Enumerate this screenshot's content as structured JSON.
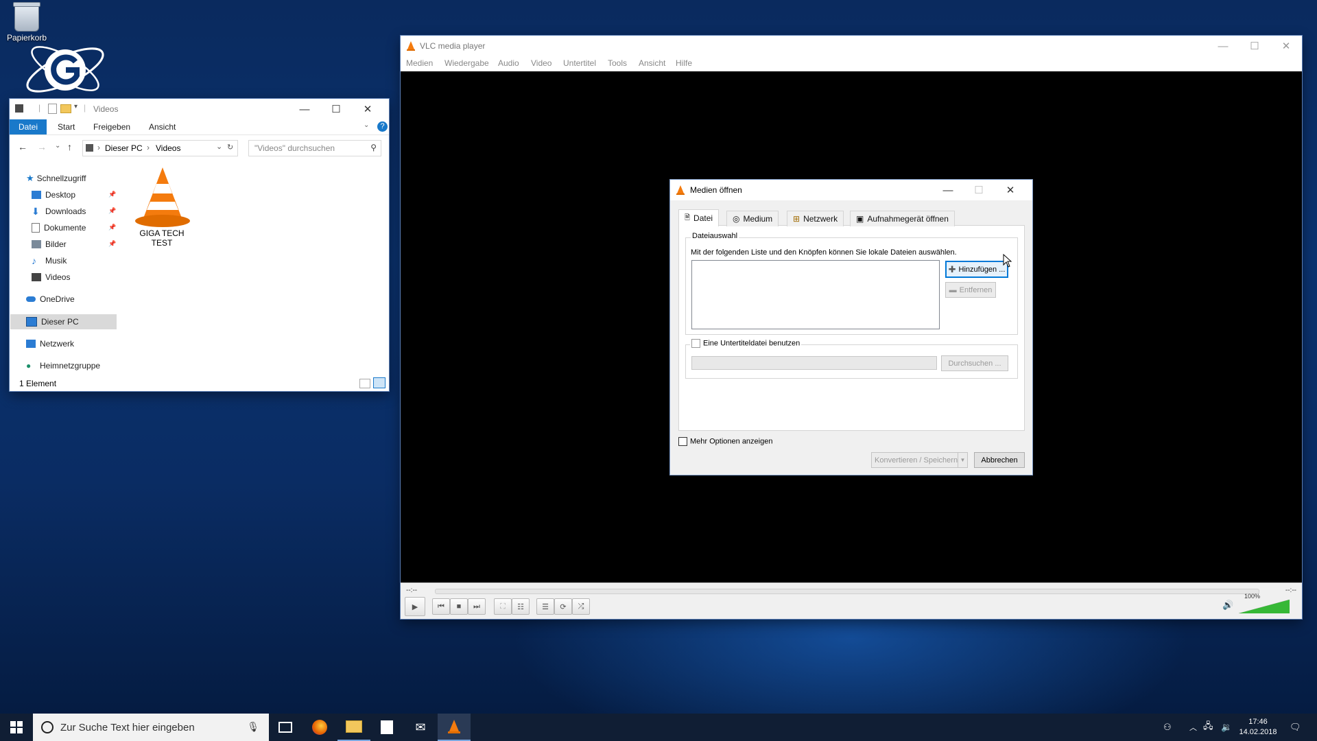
{
  "desktop": {
    "icon_label": "Papierkorb"
  },
  "explorer": {
    "title": "Videos",
    "ribbon": {
      "file": "Datei",
      "start": "Start",
      "share": "Freigeben",
      "view": "Ansicht"
    },
    "address": {
      "crumbs": [
        "Dieser PC",
        "Videos"
      ]
    },
    "search_placeholder": "\"Videos\" durchsuchen",
    "sidebar": {
      "quick_access": "Schnellzugriff",
      "items": [
        "Desktop",
        "Downloads",
        "Dokumente",
        "Bilder",
        "Musik",
        "Videos"
      ],
      "onedrive": "OneDrive",
      "this_pc": "Dieser PC",
      "network": "Netzwerk",
      "homegroup": "Heimnetzgruppe"
    },
    "file": {
      "name": "GIGA TECH TEST"
    },
    "status": "1 Element"
  },
  "vlc": {
    "title": "VLC media player",
    "menu": [
      "Medien",
      "Wiedergabe",
      "Audio",
      "Video",
      "Untertitel",
      "Tools",
      "Ansicht",
      "Hilfe"
    ],
    "time_left": "--:--",
    "time_right": "--:--",
    "volume_label": "100%",
    "volume_fraction": 1.0
  },
  "dialog": {
    "title": "Medien öffnen",
    "tabs": [
      "Datei",
      "Medium",
      "Netzwerk",
      "Aufnahmegerät öffnen"
    ],
    "group_title": "Dateiauswahl",
    "description": "Mit der folgenden Liste und den Knöpfen können Sie lokale Dateien auswählen.",
    "add_button": "Hinzufügen ...",
    "remove_button": "Entfernen",
    "subtitle_checkbox": "Eine Untertiteldatei benutzen",
    "browse_button": "Durchsuchen ...",
    "more_options": "Mehr Optionen anzeigen",
    "convert_button": "Konvertieren / Speichern",
    "cancel_button": "Abbrechen"
  },
  "taskbar": {
    "search_placeholder": "Zur Suche Text hier eingeben",
    "time": "17:46",
    "date": "14.02.2018"
  }
}
